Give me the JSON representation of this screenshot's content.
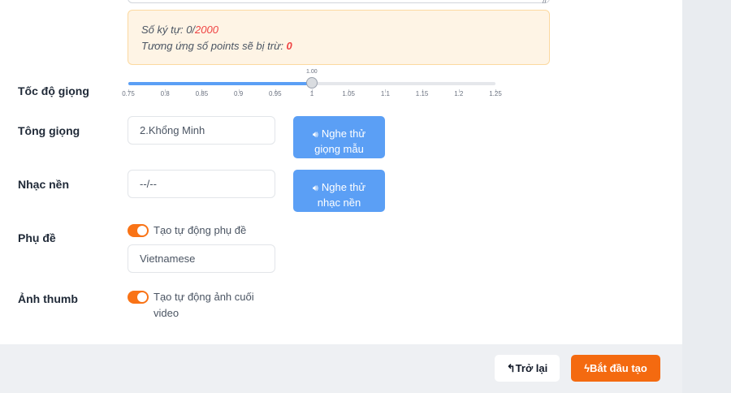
{
  "info": {
    "char_count_label": "Số ký tự: 0/",
    "char_count_max": "2000",
    "points_label": "Tương ứng số points sẽ bị trừ: ",
    "points_value": "0"
  },
  "speed": {
    "label": "Tốc độ giọng",
    "value_label": "1.00",
    "value": 1.0,
    "min": 0.75,
    "max": 1.25,
    "ticks": [
      "0.75",
      "0.8",
      "0.85",
      "0.9",
      "0.95",
      "1",
      "1.05",
      "1.1",
      "1.15",
      "1.2",
      "1.25"
    ]
  },
  "voice": {
    "label": "Tông giọng",
    "value": "2.Khổng Minh",
    "button_line1": "Nghe thử",
    "button_line2": "giọng mẫu",
    "button_icon": "speaker-icon"
  },
  "music": {
    "label": "Nhạc nền",
    "value": "--/--",
    "button_line1": "Nghe thử",
    "button_line2": "nhạc nền",
    "button_icon": "speaker-icon"
  },
  "subtitle": {
    "label": "Phụ đề",
    "toggle_text": "Tạo tự động phụ đề",
    "toggle_on": true,
    "language": "Vietnamese"
  },
  "thumb": {
    "label": "Ảnh thumb",
    "toggle_text_line1": "Tạo tự động ảnh cuối",
    "toggle_text_line2": "video",
    "toggle_on": true
  },
  "footer": {
    "back_label": "Trở lại",
    "back_icon": "reply-arrow-icon",
    "start_label": "Bắt đầu tạo",
    "start_icon": "lightning-icon"
  },
  "colors": {
    "accent_orange": "#f46a10",
    "button_blue": "#5b9ff5",
    "warning_bg": "#fef4e5"
  }
}
